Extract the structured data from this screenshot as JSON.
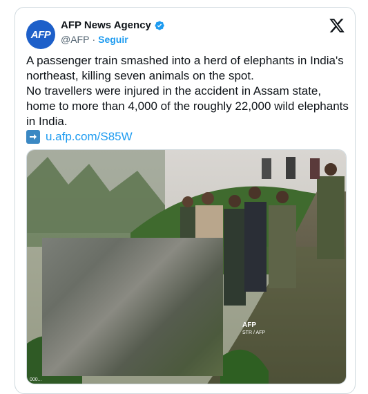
{
  "tweet": {
    "avatar_text": "AFP",
    "display_name": "AFP News Agency",
    "handle": "@AFP",
    "separator": "·",
    "follow_label": "Seguir",
    "text_lines": [
      "A passenger train smashed into a herd of elephants in India's northeast, killing seven animals on the spot.",
      "No travellers were injured in the accident in Assam state, home to more than 4,000 of the roughly 22,000 wild elephants in India."
    ],
    "link_text": "u.afp.com/S85W"
  },
  "media": {
    "watermark_logo": "AFP",
    "watermark_credit": "STR / AFP",
    "corner_tag": "000..."
  },
  "icons": {
    "verified": "verified-badge-icon",
    "platform": "x-logo-icon",
    "link_arrow": "arrow-right-icon"
  },
  "colors": {
    "brand_blue": "#1d9bf0",
    "afp_avatar": "#1d5fc9",
    "text_primary": "#0f1419",
    "text_secondary": "#536471"
  }
}
